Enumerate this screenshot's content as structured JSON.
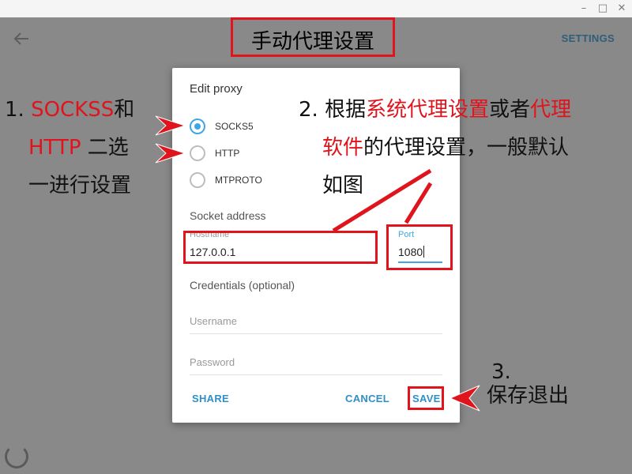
{
  "page_title": "手动代理设置",
  "topbar": {
    "back_icon": "arrow-left-icon",
    "settings_label": "SETTINGS"
  },
  "window_controls": {
    "minimize": "–",
    "maximize": "□",
    "close": "✕"
  },
  "dialog": {
    "title": "Edit proxy",
    "proxy_types": [
      {
        "label": "SOCKS5",
        "selected": true
      },
      {
        "label": "HTTP",
        "selected": false
      },
      {
        "label": "MTPROTO",
        "selected": false
      }
    ],
    "socket_address_label": "Socket address",
    "hostname": {
      "label": "Hostname",
      "value": "127.0.0.1"
    },
    "port": {
      "label": "Port",
      "value": "1080"
    },
    "credentials_label": "Credentials (optional)",
    "username": {
      "placeholder": "Username"
    },
    "password": {
      "placeholder": "Password"
    },
    "buttons": {
      "share": "SHARE",
      "cancel": "CANCEL",
      "save": "SAVE"
    }
  },
  "annotations": {
    "note1": {
      "num": "1.",
      "socks": "SOCKSS",
      "and": "和",
      "http": "HTTP",
      "line2_rest": " 二选",
      "line3": "一进行设置"
    },
    "note2": {
      "num": "2.",
      "pre": "根据",
      "red1": "系统代理设置",
      "mid": "或者",
      "red2a": "代理",
      "red2b": "软件",
      "rest2": "的代理设置，一般默认",
      "line3": "如图"
    },
    "note3": {
      "num": "3.",
      "text": "保存退出"
    }
  },
  "colors": {
    "accent": "#40a7e3",
    "annotation_red": "#e0141d",
    "overlay": "#898989"
  }
}
